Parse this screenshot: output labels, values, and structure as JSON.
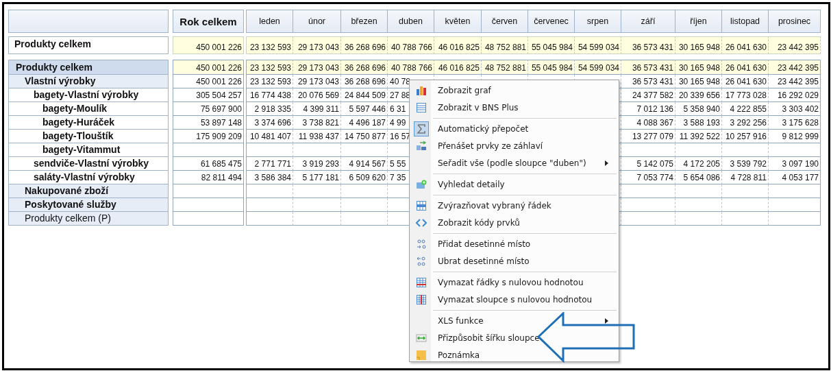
{
  "header": {
    "total": "Rok celkem",
    "months": [
      "leden",
      "únor",
      "březen",
      "duben",
      "květen",
      "červen",
      "červenec",
      "srpen",
      "září",
      "říjen",
      "listopad",
      "prosinec"
    ]
  },
  "summary": {
    "label": "Produkty celkem",
    "total": "450 001 226",
    "values": [
      "23 132 593",
      "29 173 043",
      "36 268 696",
      "40 788 766",
      "46 016 825",
      "48 752 881",
      "55 045 984",
      "54 599 034",
      "36 573 431",
      "30 165 948",
      "26 041 630",
      "23 442 395"
    ]
  },
  "tree": [
    {
      "label": "Produkty celkem",
      "bold": true,
      "total": "450 001 226",
      "values": [
        "23 132 593",
        "29 173 043",
        "36 268 696",
        "40 788 766",
        "46 016 825",
        "48 752 881",
        "55 045 984",
        "54 599 034",
        "36 573 431",
        "30 165 948",
        "26 041 630",
        "23 442 395"
      ],
      "children": [
        {
          "label": "Vlastní výrobky",
          "bold": true,
          "total": "450 001 226",
          "values_left": [
            "23 132 593",
            "29 173 043",
            "36 268 696",
            "40 78"
          ],
          "values_right": [
            "36 573 431",
            "30 165 948",
            "26 041 630",
            "23 442 395"
          ],
          "children": [
            {
              "label": "bagety-Vlastní výrobky",
              "bold": true,
              "total": "305 504 257",
              "values_left": [
                "16 774 438",
                "20 076 569",
                "24 844 509",
                "27 88"
              ],
              "values_right": [
                "24 377 582",
                "20 339 656",
                "17 773 028",
                "16 292 029"
              ],
              "children": [
                {
                  "label": "bagety-Moulík",
                  "bold": true,
                  "total": "75 697 900",
                  "values_left": [
                    "2 918 335",
                    "4 399 311",
                    "5 597 446",
                    "6 31"
                  ],
                  "values_right": [
                    "7 012 136",
                    "5 358 940",
                    "4 222 855",
                    "3 303 402"
                  ]
                },
                {
                  "label": "bagety-Huráček",
                  "bold": true,
                  "total": "53 897 148",
                  "values_left": [
                    "3 374 696",
                    "3 738 821",
                    "4 496 187",
                    "4 99"
                  ],
                  "values_right": [
                    "4 088 367",
                    "3 588 193",
                    "3 292 256",
                    "3 175 628"
                  ]
                },
                {
                  "label": "bagety-Tlouštík",
                  "bold": true,
                  "total": "175 909 209",
                  "values_left": [
                    "10 481 407",
                    "11 938 437",
                    "14 750 877",
                    "16 57"
                  ],
                  "values_right": [
                    "13 277 079",
                    "11 392 522",
                    "10 257 916",
                    "9 812 999"
                  ]
                },
                {
                  "label": "bagety-Vitammut",
                  "bold": true
                }
              ]
            },
            {
              "label": "sendviče-Vlastní výrobky",
              "bold": true,
              "total": "61 685 475",
              "values_left": [
                "2 771 771",
                "3 919 293",
                "4 914 567",
                "5 55"
              ],
              "values_right": [
                "5 142 075",
                "4 172 205",
                "3 539 792",
                "3 097 190"
              ]
            },
            {
              "label": "saláty-Vlastní výrobky",
              "bold": true,
              "total": "82 811 494",
              "values_left": [
                "3 586 384",
                "5 177 181",
                "6 509 620",
                "7 35"
              ],
              "values_right": [
                "7 053 774",
                "5 654 086",
                "4 728 811",
                "4 053 177"
              ]
            }
          ]
        },
        {
          "label": "Nakupované zboží",
          "bold": true
        },
        {
          "label": "Poskytované služby",
          "bold": true
        },
        {
          "label": "Produkty celkem (P)",
          "bold": false
        }
      ]
    }
  ],
  "menu": [
    {
      "kind": "item",
      "label": "Zobrazit graf",
      "checked": false,
      "submenu": false
    },
    {
      "kind": "item",
      "label": "Zobrazit v BNS Plus",
      "checked": false,
      "submenu": false
    },
    {
      "kind": "separator"
    },
    {
      "kind": "item",
      "label": "Automatický přepočet",
      "checked": true,
      "submenu": false
    },
    {
      "kind": "item",
      "label": "Přenášet prvky ze záhlaví",
      "checked": false,
      "submenu": false
    },
    {
      "kind": "item",
      "label": "Seřadit vše (podle sloupce \"duben\")",
      "checked": false,
      "submenu": true
    },
    {
      "kind": "separator"
    },
    {
      "kind": "item",
      "label": "Vyhledat detaily",
      "checked": false,
      "submenu": false
    },
    {
      "kind": "separator"
    },
    {
      "kind": "item",
      "label": "Zvýrazňovat vybraný řádek",
      "checked": false,
      "submenu": false
    },
    {
      "kind": "item",
      "label": "Zobrazit kódy prvků",
      "checked": false,
      "submenu": false
    },
    {
      "kind": "separator"
    },
    {
      "kind": "item",
      "label": "Přidat desetinné místo",
      "checked": false,
      "submenu": false
    },
    {
      "kind": "item",
      "label": "Ubrat desetinné místo",
      "checked": false,
      "submenu": false
    },
    {
      "kind": "separator"
    },
    {
      "kind": "item",
      "label": "Vymazat řádky s nulovou hodnotou",
      "checked": false,
      "submenu": false
    },
    {
      "kind": "item",
      "label": "Vymazat sloupce s nulovou hodnotou",
      "checked": false,
      "submenu": false
    },
    {
      "kind": "separator"
    },
    {
      "kind": "item",
      "label": "XLS funkce",
      "checked": false,
      "submenu": true
    },
    {
      "kind": "item",
      "label": "Přizpůsobit šířku sloupce",
      "checked": false,
      "submenu": false
    },
    {
      "kind": "item",
      "label": "Poznámka",
      "checked": false,
      "submenu": false
    }
  ]
}
